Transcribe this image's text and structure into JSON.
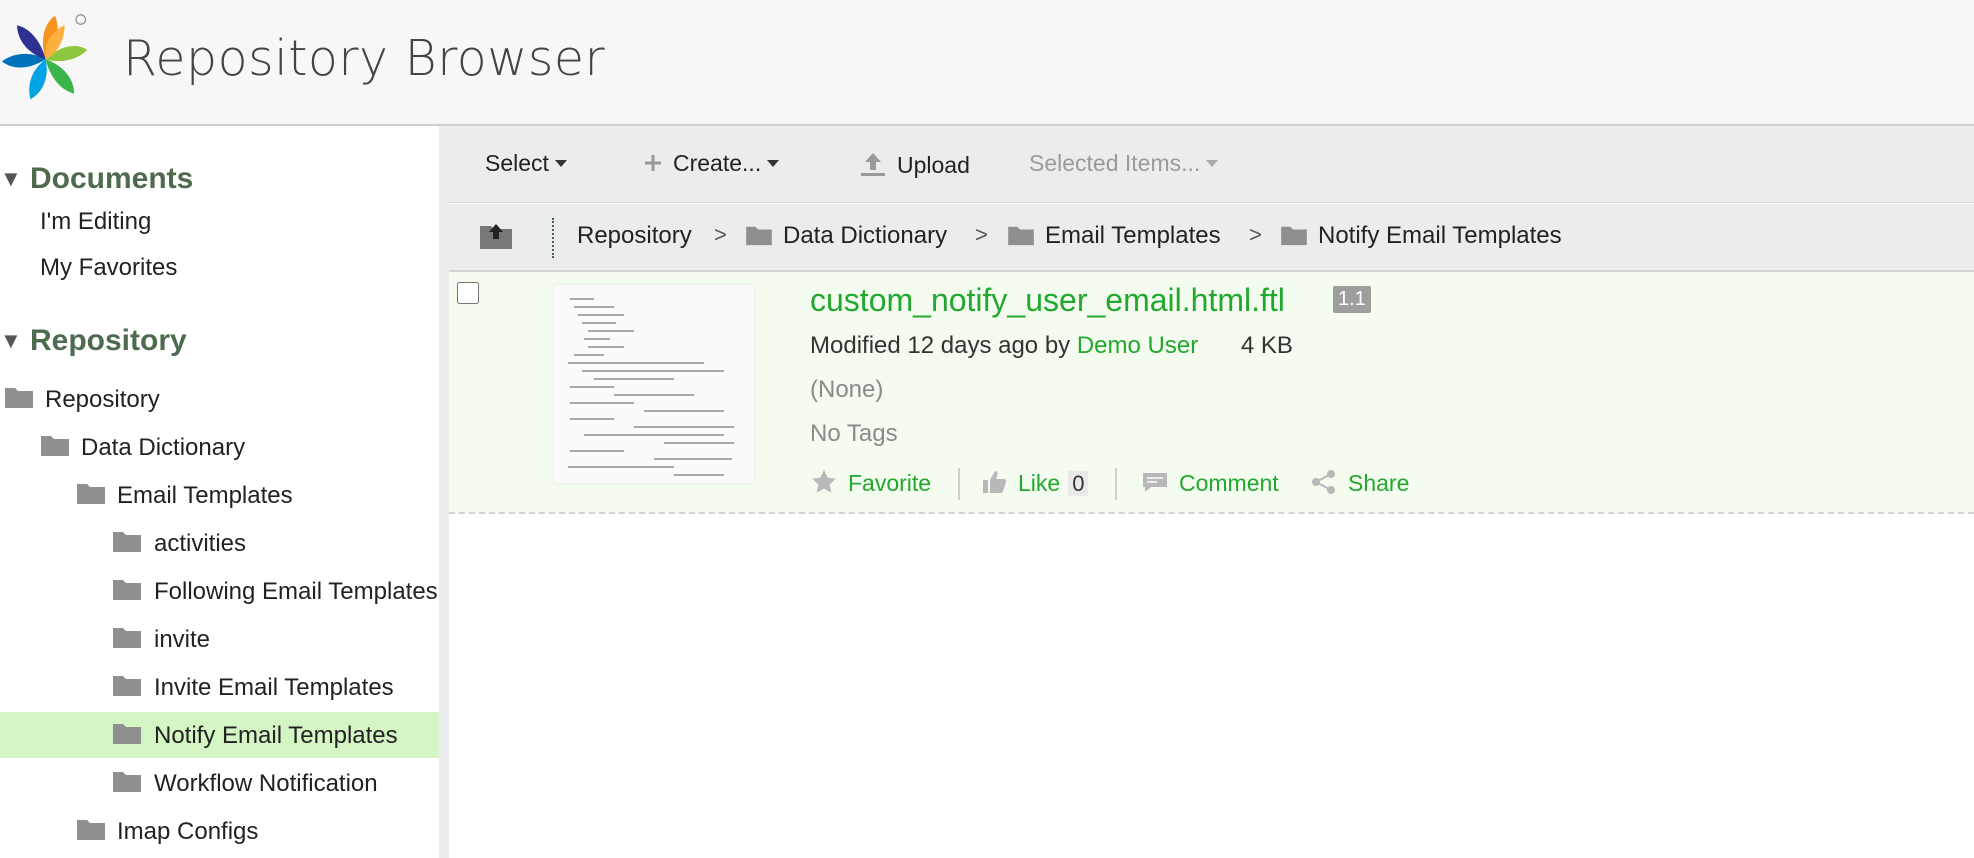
{
  "app": {
    "title": "Repository Browser"
  },
  "sidebar": {
    "documents_heading": "Documents",
    "document_links": [
      "I'm Editing",
      "My Favorites"
    ],
    "repository_heading": "Repository",
    "tree": [
      {
        "label": "Repository",
        "level": 0,
        "selected": false
      },
      {
        "label": "Data Dictionary",
        "level": 1,
        "selected": false
      },
      {
        "label": "Email Templates",
        "level": 2,
        "selected": false
      },
      {
        "label": "activities",
        "level": 3,
        "selected": false
      },
      {
        "label": "Following Email Templates",
        "level": 3,
        "selected": false
      },
      {
        "label": "invite",
        "level": 3,
        "selected": false
      },
      {
        "label": "Invite Email Templates",
        "level": 3,
        "selected": false
      },
      {
        "label": "Notify Email Templates",
        "level": 3,
        "selected": true
      },
      {
        "label": "Workflow Notification",
        "level": 3,
        "selected": false
      },
      {
        "label": "Imap Configs",
        "level": 2,
        "selected": false
      }
    ]
  },
  "toolbar": {
    "select_label": "Select",
    "create_label": "Create...",
    "upload_label": "Upload",
    "selected_items_label": "Selected Items..."
  },
  "breadcrumb": {
    "items": [
      "Repository",
      "Data Dictionary",
      "Email Templates",
      "Notify Email Templates"
    ],
    "separator": ">"
  },
  "document": {
    "name": "custom_notify_user_email.html.ftl",
    "version": "1.1",
    "modified_prefix": "Modified 12 days ago by",
    "modified_by": "Demo User",
    "size": "4 KB",
    "description": "(None)",
    "tags": "No Tags",
    "favorite_label": "Favorite",
    "like_label": "Like",
    "like_count": "0",
    "comment_label": "Comment",
    "share_label": "Share"
  },
  "colors": {
    "accent_green": "#22a82f",
    "heading_green": "#4e6b4f",
    "selected_bg": "#d4f5c4",
    "row_bg": "#f3fcef"
  }
}
